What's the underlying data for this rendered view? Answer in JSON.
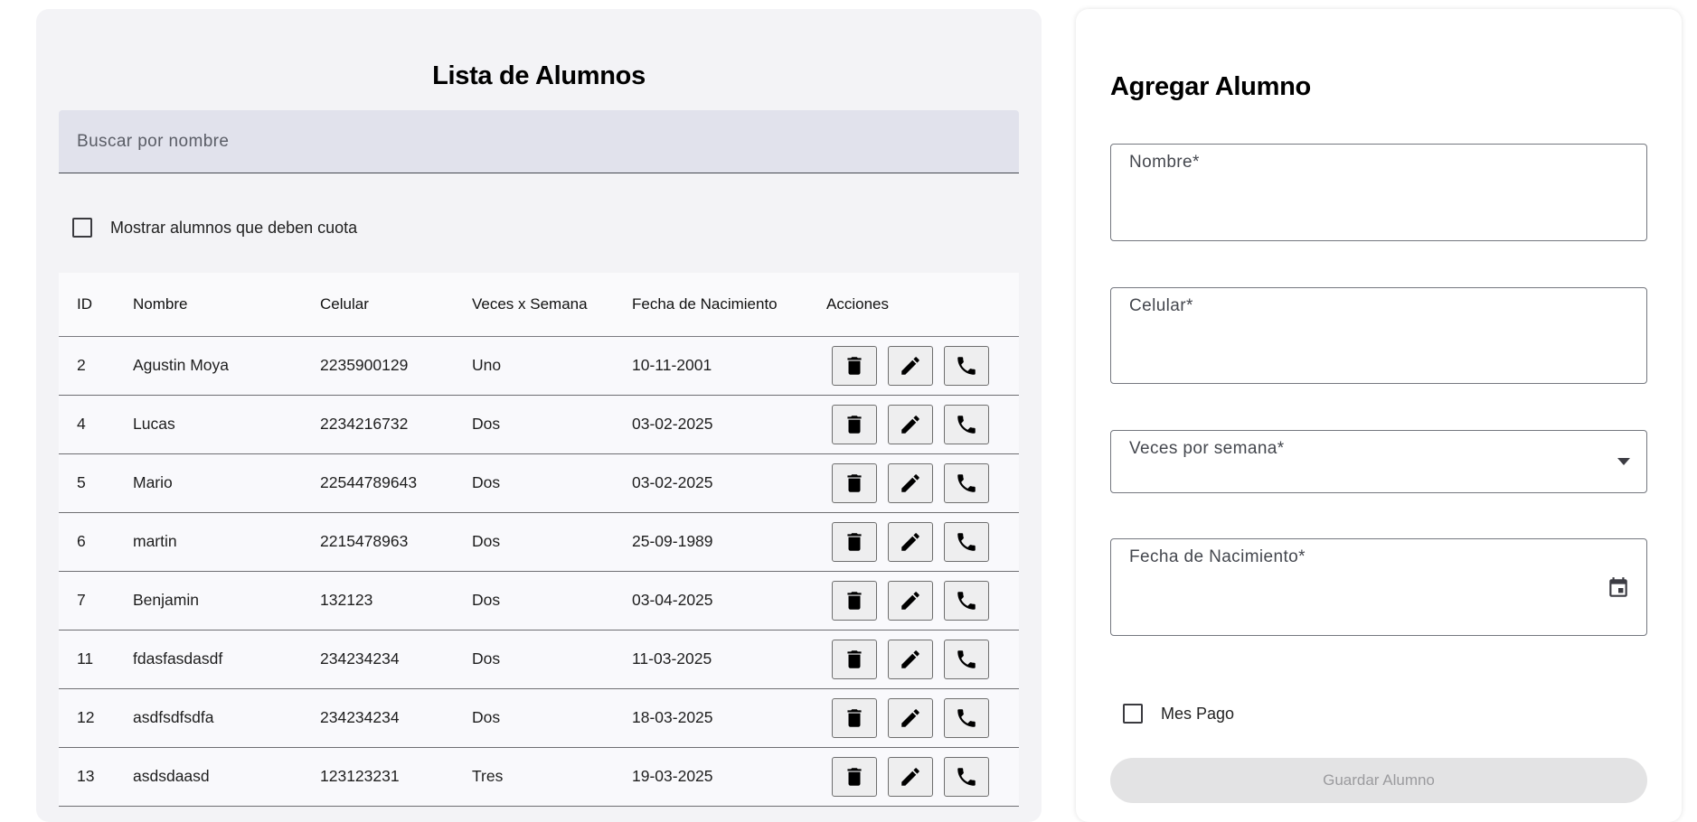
{
  "list": {
    "title": "Lista de Alumnos",
    "search_placeholder": "Buscar por nombre",
    "filter_label": "Mostrar alumnos que deben cuota",
    "filter_checked": false,
    "columns": [
      "ID",
      "Nombre",
      "Celular",
      "Veces x Semana",
      "Fecha de Nacimiento",
      "Acciones"
    ],
    "rows": [
      {
        "id": "2",
        "nombre": "Agustin Moya",
        "celular": "2235900129",
        "veces": "Uno",
        "fecha": "10-11-2001"
      },
      {
        "id": "4",
        "nombre": "Lucas",
        "celular": "2234216732",
        "veces": "Dos",
        "fecha": "03-02-2025"
      },
      {
        "id": "5",
        "nombre": "Mario",
        "celular": "22544789643",
        "veces": "Dos",
        "fecha": "03-02-2025"
      },
      {
        "id": "6",
        "nombre": "martin",
        "celular": "2215478963",
        "veces": "Dos",
        "fecha": "25-09-1989"
      },
      {
        "id": "7",
        "nombre": "Benjamin",
        "celular": "132123",
        "veces": "Dos",
        "fecha": "03-04-2025"
      },
      {
        "id": "11",
        "nombre": "fdasfasdasdf",
        "celular": "234234234",
        "veces": "Dos",
        "fecha": "11-03-2025"
      },
      {
        "id": "12",
        "nombre": "asdfsdfsdfa",
        "celular": "234234234",
        "veces": "Dos",
        "fecha": "18-03-2025"
      },
      {
        "id": "13",
        "nombre": "asdsdaasd",
        "celular": "123123231",
        "veces": "Tres",
        "fecha": "19-03-2025"
      }
    ],
    "row_action_icons": [
      "delete-icon",
      "edit-icon",
      "phone-icon"
    ]
  },
  "form": {
    "title": "Agregar Alumno",
    "nombre_label": "Nombre*",
    "celular_label": "Celular*",
    "veces_label": "Veces por semana*",
    "fecha_label": "Fecha de Nacimiento*",
    "mes_pago_label": "Mes Pago",
    "mes_pago_checked": false,
    "save_label": "Guardar Alumno"
  },
  "colors": {
    "left_card_bg": "#f3f3f6",
    "search_bg": "#e1e2ec",
    "save_disabled_bg": "#e3e3e4",
    "save_disabled_text": "#9b9b9e"
  }
}
